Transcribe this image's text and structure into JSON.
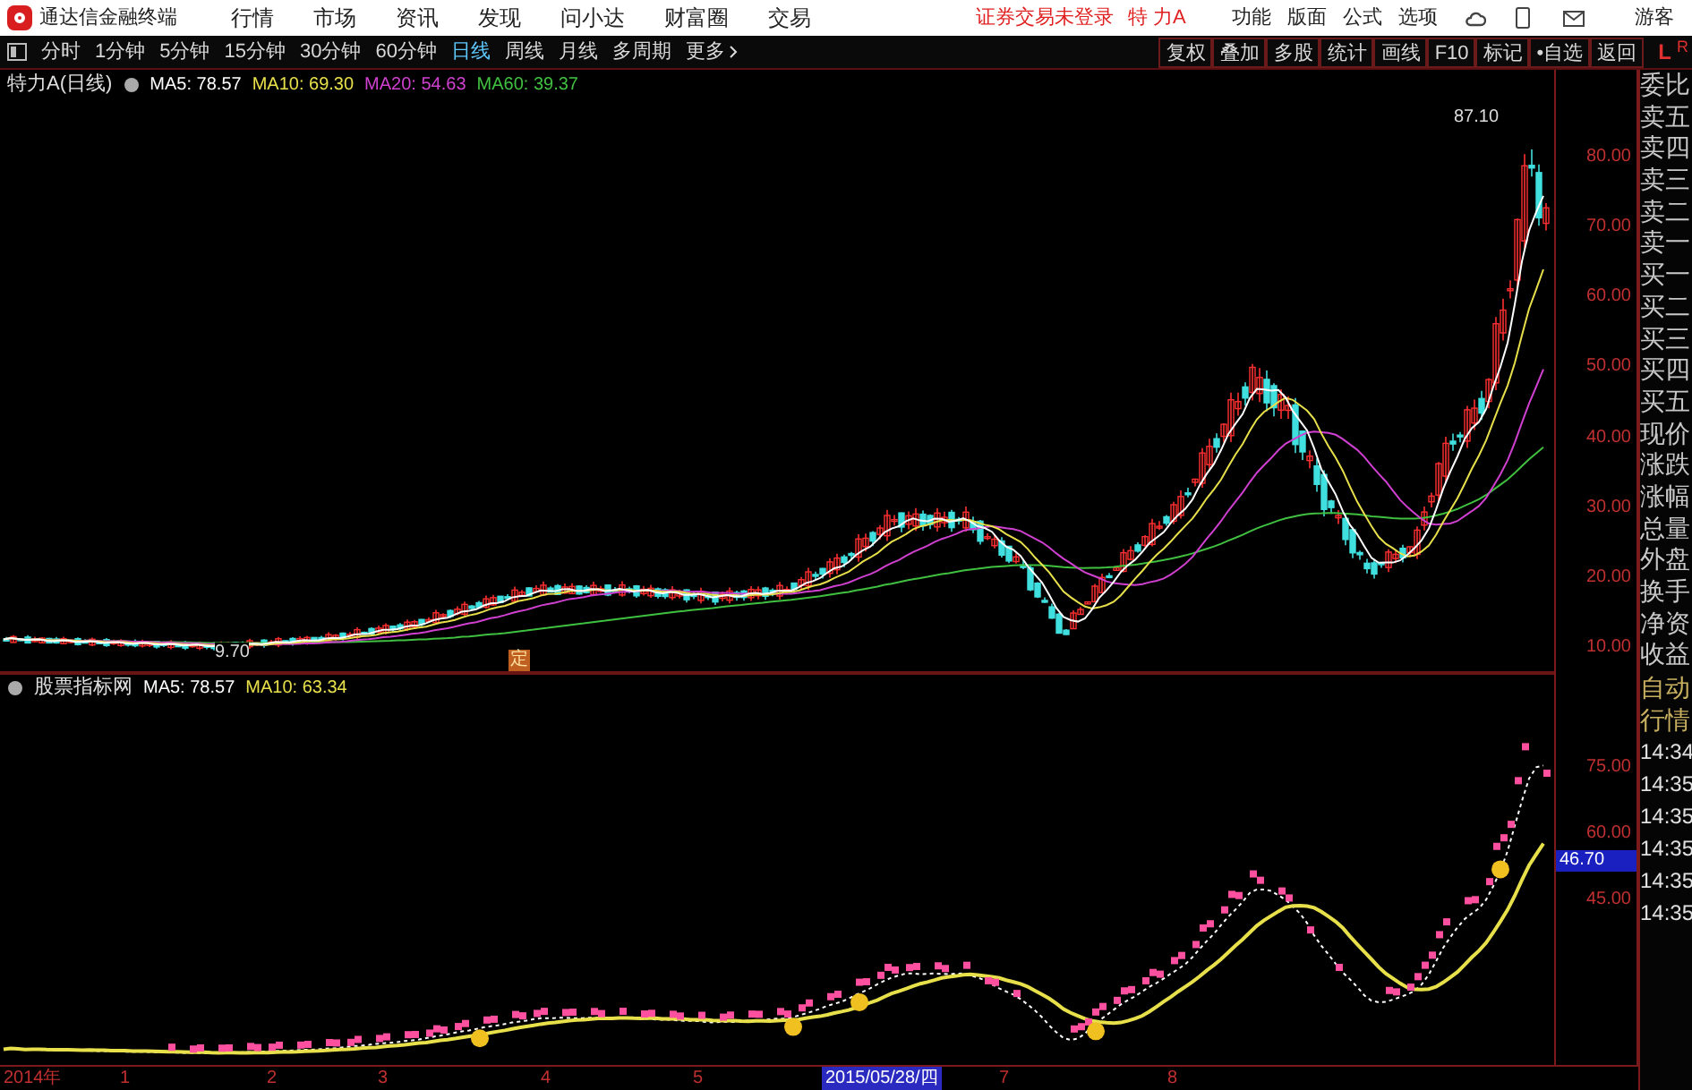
{
  "app": {
    "title": "通达信金融终端"
  },
  "menu": [
    "行情",
    "市场",
    "资讯",
    "发现",
    "问小达",
    "财富圈",
    "交易"
  ],
  "login_status": "证券交易未登录",
  "stock_name": "特 力A",
  "top_actions": [
    "功能",
    "版面",
    "公式",
    "选项"
  ],
  "user": "游客",
  "periods": [
    {
      "label": "分时",
      "selected": false
    },
    {
      "label": "1分钟",
      "selected": false
    },
    {
      "label": "5分钟",
      "selected": false
    },
    {
      "label": "15分钟",
      "selected": false
    },
    {
      "label": "30分钟",
      "selected": false
    },
    {
      "label": "60分钟",
      "selected": false
    },
    {
      "label": "日线",
      "selected": true
    },
    {
      "label": "周线",
      "selected": false
    },
    {
      "label": "月线",
      "selected": false
    },
    {
      "label": "多周期",
      "selected": false
    }
  ],
  "more": "更多",
  "tools": [
    "复权",
    "叠加",
    "多股",
    "统计",
    "画线",
    "F10",
    "标记",
    "•自选",
    "返回"
  ],
  "corner": {
    "left": "L",
    "right": "R"
  },
  "main_legend": {
    "title": "特力A(日线)",
    "items": [
      {
        "label": "MA5: 78.57",
        "color": "#ffffff"
      },
      {
        "label": "MA10: 69.30",
        "color": "#e8e04a"
      },
      {
        "label": "MA20: 54.63",
        "color": "#d040d0"
      },
      {
        "label": "MA60: 39.37",
        "color": "#40c040"
      }
    ]
  },
  "price_axis": [
    "80.00",
    "70.00",
    "60.00",
    "50.00",
    "40.00",
    "30.00",
    "20.00",
    "10.00"
  ],
  "high_label": "87.10",
  "low_label": "9.70",
  "marker": "定",
  "indicator_legend": {
    "title": "股票指标网",
    "items": [
      {
        "label": "MA5: 78.57",
        "color": "#ffffff"
      },
      {
        "label": "MA10: 63.34",
        "color": "#e8e04a"
      }
    ]
  },
  "indicator_axis": [
    "75.00",
    "60.00",
    "45.00"
  ],
  "indicator_cursor": "46.70",
  "date_axis": [
    {
      "label": "2014年",
      "selected": false
    },
    {
      "label": "1",
      "selected": false
    },
    {
      "label": "2",
      "selected": false
    },
    {
      "label": "3",
      "selected": false
    },
    {
      "label": "4",
      "selected": false
    },
    {
      "label": "5",
      "selected": false
    },
    {
      "label": "2015/05/28/四",
      "selected": true
    },
    {
      "label": "7",
      "selected": false
    },
    {
      "label": "8",
      "selected": false
    }
  ],
  "side_panel": {
    "quote_labels": [
      "委比",
      "卖五",
      "卖四",
      "卖三",
      "卖二",
      "卖一",
      "买一",
      "买二",
      "买三",
      "买四",
      "买五",
      "现价",
      "涨跌",
      "涨幅",
      "总量",
      "外盘",
      "换手",
      "净资",
      "收益"
    ],
    "tabs": [
      "自动",
      "行情"
    ],
    "times": [
      "14:34",
      "14:35",
      "14:35",
      "14:35",
      "14:35",
      "14:35"
    ]
  }
}
